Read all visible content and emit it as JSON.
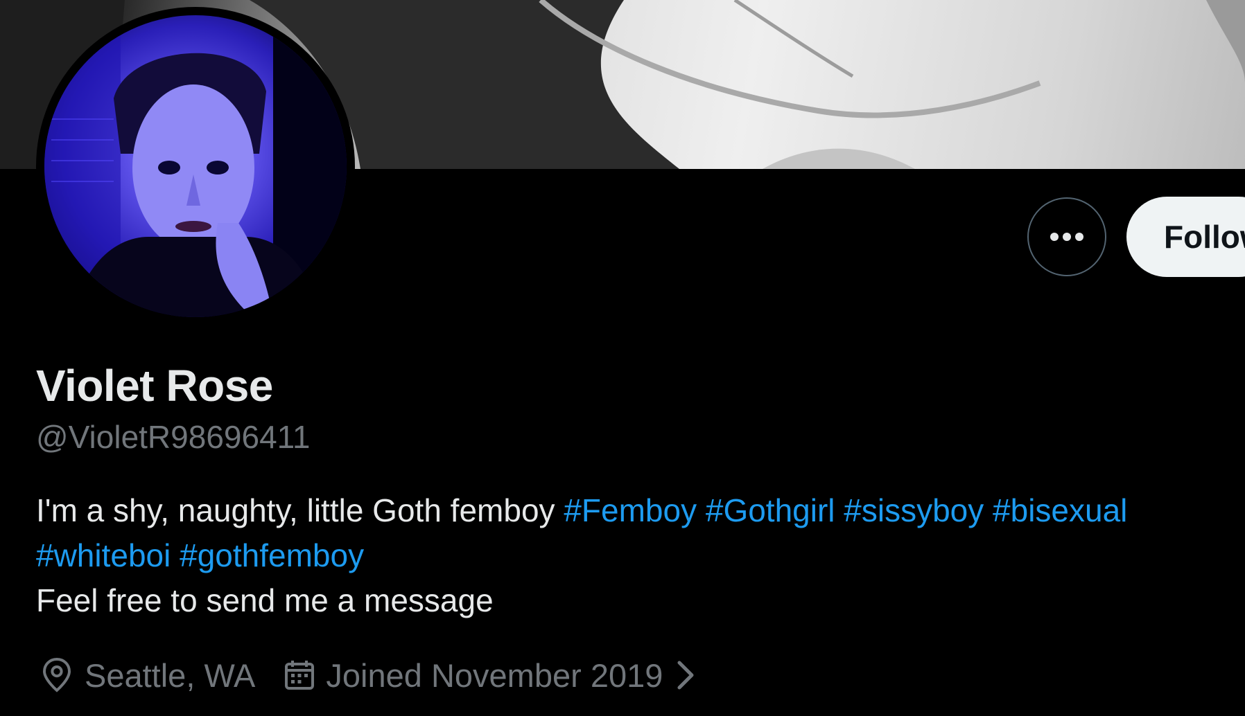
{
  "profile": {
    "display_name": "Violet Rose",
    "handle": "@VioletR98696411",
    "bio": {
      "line1_text": "I'm a shy, naughty, little Goth femboy",
      "line1_hashtags": [
        "#Femboy",
        "#Gothgirl",
        "#sissyboy",
        "#bisexual"
      ],
      "line2_hashtags": [
        "#whiteboi",
        "#gothfemboy"
      ],
      "line3_text": "Feel free to send me a message"
    },
    "location": "Seattle, WA",
    "joined": "Joined November 2019"
  },
  "actions": {
    "more_icon": "more-horizontal-icon",
    "follow_label": "Follow"
  },
  "icons": {
    "location": "location-pin-icon",
    "joined": "calendar-icon",
    "chevron": "chevron-right-icon"
  },
  "colors": {
    "background": "#000000",
    "text_primary": "#e7e9ea",
    "text_secondary": "#71767b",
    "hashtag": "#1d9bf0",
    "follow_bg": "#eff3f4"
  }
}
